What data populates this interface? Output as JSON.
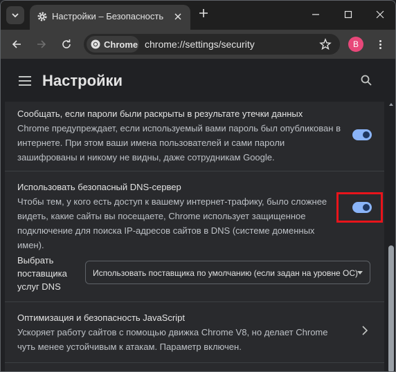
{
  "window": {
    "tab_title": "Настройки – Безопасность",
    "controls": [
      "minimize",
      "maximize",
      "close"
    ]
  },
  "toolbar": {
    "chip_label": "Chrome",
    "url": "chrome://settings/security",
    "avatar_letter": "B",
    "avatar_color": "#e8487a"
  },
  "header": {
    "title": "Настройки"
  },
  "settings": {
    "leak_check": {
      "title": "Сообщать, если пароли были раскрыты в результате утечки данных",
      "description": "Chrome предупреждает, если используемый вами пароль был опубликован в интернете. При этом ваши имена пользователей и сами пароли зашифрованы и никому не видны, даже сотрудникам Google.",
      "enabled": true
    },
    "secure_dns": {
      "title": "Использовать безопасный DNS-сервер",
      "description": "Чтобы тем, у кого есть доступ к вашему интернет-трафику, было сложнее видеть, какие сайты вы посещаете, Chrome использует защищенное подключение для поиска IP-адресов сайтов в DNS (системе доменных имен).",
      "enabled": true,
      "highlight_color": "#e8141b"
    },
    "dns_provider": {
      "label": "Выбрать поставщика услуг DNS",
      "selected": "Использовать поставщика по умолчанию (если задан на уровне ОС)"
    },
    "v8_optimizer": {
      "title": "Оптимизация и безопасность JavaScript",
      "description": "Ускоряет работу сайтов с помощью движка Chrome V8, но делает Chrome чуть менее устойчивым к атакам. Параметр включен."
    }
  },
  "colors": {
    "accent": "#8ab4f8",
    "card_bg": "#292a2d",
    "page_bg": "#202124"
  }
}
